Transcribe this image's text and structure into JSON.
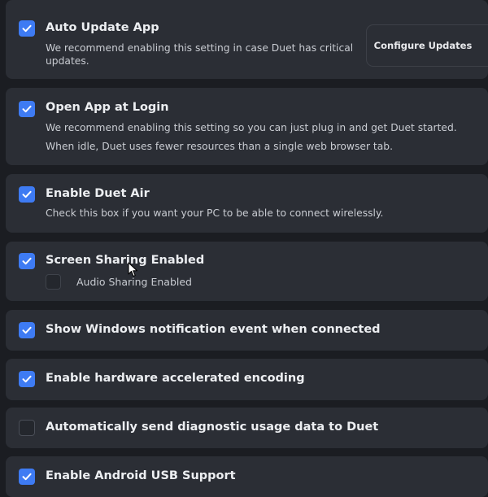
{
  "settings": [
    {
      "id": "auto-update",
      "checked": true,
      "title": "Auto Update App",
      "description": [
        "We recommend enabling this setting in case Duet has critical",
        "updates."
      ],
      "button": "Configure Updates"
    },
    {
      "id": "open-at-login",
      "checked": true,
      "title": "Open App at Login",
      "description": [
        "We recommend enabling this setting so you can just plug in and get Duet started.",
        "When idle, Duet uses fewer resources than a single web browser tab."
      ]
    },
    {
      "id": "duet-air",
      "checked": true,
      "title": "Enable Duet Air",
      "description": [
        "Check this box if you want your PC to be able to connect wirelessly."
      ]
    },
    {
      "id": "screen-sharing",
      "checked": true,
      "title": "Screen Sharing Enabled",
      "sub_option": {
        "checked": false,
        "label": "Audio Sharing Enabled"
      }
    },
    {
      "id": "windows-notification",
      "checked": true,
      "title": "Show Windows notification event when connected"
    },
    {
      "id": "hw-encoding",
      "checked": true,
      "title": "Enable hardware accelerated encoding"
    },
    {
      "id": "diagnostics",
      "checked": false,
      "title": "Automatically send diagnostic usage data to Duet"
    },
    {
      "id": "android-usb",
      "checked": true,
      "title": "Enable Android USB Support"
    }
  ],
  "colors": {
    "accent": "#3e7bf3",
    "card": "#2b2e35",
    "background": "#1b1d22"
  },
  "icons": {
    "checkmark": "check-icon",
    "cursor": "mouse-pointer-icon"
  }
}
